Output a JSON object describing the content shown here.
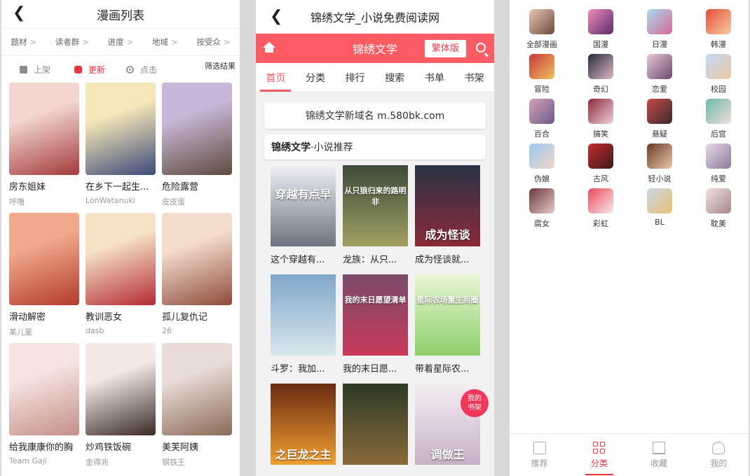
{
  "panel1": {
    "title": "漫画列表",
    "filters": [
      "题材",
      "读者群",
      "进度",
      "地域",
      "按受众"
    ],
    "sort": {
      "shelf": "上架",
      "update": "更新",
      "click": "点击"
    },
    "filter_result": "筛选结果",
    "comics": [
      {
        "title": "房东姐妹",
        "author": "呼噜",
        "c1": "#f3d6d0",
        "c2": "#a33a3a"
      },
      {
        "title": "在乡下一起生...",
        "author": "LonWatanuki",
        "c1": "#f6e7b8",
        "c2": "#3b4a78"
      },
      {
        "title": "危险露营",
        "author": "皮皮蛋",
        "c1": "#c9b6d8",
        "c2": "#5d4b3c"
      },
      {
        "title": "滑动解密",
        "author": "某儿童",
        "c1": "#f0a98c",
        "c2": "#b43a2c"
      },
      {
        "title": "教训恶女",
        "author": "dasb",
        "c1": "#f6e2c5",
        "c2": "#b32a34"
      },
      {
        "title": "孤儿复仇记",
        "author": "26",
        "c1": "#f4dccd",
        "c2": "#8e4b3a"
      },
      {
        "title": "给我康康你的胸",
        "author": "Team Gaji",
        "c1": "#f6e4df",
        "c2": "#c48f8a"
      },
      {
        "title": "炒鸡铁饭碗",
        "author": "金得兆",
        "c1": "#f2e9e4",
        "c2": "#3a2a26"
      },
      {
        "title": "美芙阿姨",
        "author": "钢铁王",
        "c1": "#e9dcd6",
        "c2": "#8a6a58"
      }
    ]
  },
  "panel2": {
    "title": "锦绣文学_小说免费阅读网",
    "brand": "锦绣文学",
    "traditional_btn": "繁体版",
    "nav": [
      "首页",
      "分类",
      "排行",
      "搜索",
      "书单",
      "书架"
    ],
    "notice": "锦绣文学新域名 m.580bk.com",
    "section_brand": "锦绣文学",
    "section_rest": "·小说推荐",
    "fab_line1": "我的",
    "fab_line2": "书架",
    "books": [
      {
        "title": "这个穿越有...",
        "cover_text": "穿越有点早",
        "c1": "#eef1f6",
        "c2": "#6d7581"
      },
      {
        "title": "龙族：从只...",
        "cover_text": "从只狼归来的路明非",
        "c1": "#3c4a3a",
        "c2": "#a0a060"
      },
      {
        "title": "成为怪谈就...",
        "cover_text": "成为怪谈",
        "c1": "#2a3346",
        "c2": "#8a2a3a"
      },
      {
        "title": "斗罗：我加...",
        "cover_text": "",
        "c1": "#7fa6c8",
        "c2": "#d9e8ee"
      },
      {
        "title": "我的末日愿...",
        "cover_text": "我的末日愿望清单",
        "c1": "#7a4a6a",
        "c2": "#c93a5a"
      },
      {
        "title": "带着星际农...",
        "cover_text": "星际农场重生到圈",
        "c1": "#e6f6d4",
        "c2": "#8ecf6a"
      },
      {
        "title": "",
        "cover_text": "之巨龙之主",
        "c1": "#6a2a10",
        "c2": "#f0a030"
      },
      {
        "title": "",
        "cover_text": "",
        "c1": "#2c3a26",
        "c2": "#8a6a3a"
      },
      {
        "title": "",
        "cover_text": "调做王",
        "c1": "#f3eef2",
        "c2": "#c7b0c8"
      }
    ]
  },
  "panel3": {
    "categories": [
      {
        "label": "全部漫画",
        "c1": "#e8c7b8",
        "c2": "#6b4a3a"
      },
      {
        "label": "国漫",
        "c1": "#f08cbc",
        "c2": "#5a2a6a"
      },
      {
        "label": "日漫",
        "c1": "#a9d8ec",
        "c2": "#d76a9a"
      },
      {
        "label": "韩漫",
        "c1": "#e84a3a",
        "c2": "#f3d0a0"
      },
      {
        "label": "冒险",
        "c1": "#c83a3a",
        "c2": "#f0c060"
      },
      {
        "label": "奇幻",
        "c1": "#2a2a3a",
        "c2": "#d8b8c8"
      },
      {
        "label": "恋爱",
        "c1": "#e8c8d8",
        "c2": "#6a4a6a"
      },
      {
        "label": "校园",
        "c1": "#c0d8f0",
        "c2": "#f0c8a8"
      },
      {
        "label": "百合",
        "c1": "#d8a0b8",
        "c2": "#6a5a8a"
      },
      {
        "label": "搞笑",
        "c1": "#8a2a3a",
        "c2": "#f0d0d8"
      },
      {
        "label": "悬疑",
        "c1": "#c84a4a",
        "c2": "#3a2a2a"
      },
      {
        "label": "后宫",
        "c1": "#6ab8a8",
        "c2": "#f0e0d8"
      },
      {
        "label": "伪娘",
        "c1": "#9ac8f0",
        "c2": "#f0d8c8"
      },
      {
        "label": "古风",
        "c1": "#c82a2a",
        "c2": "#3a1a1a"
      },
      {
        "label": "轻小说",
        "c1": "#6a3a2a",
        "c2": "#e8c8a8"
      },
      {
        "label": "纯爱",
        "c1": "#e8d8e8",
        "c2": "#8a7a9a"
      },
      {
        "label": "腐女",
        "c1": "#6a3a3a",
        "c2": "#e8c8c8"
      },
      {
        "label": "彩虹",
        "c1": "#e84a5a",
        "c2": "#f8e8e8"
      },
      {
        "label": "BL",
        "c1": "#c8d8e8",
        "c2": "#e8c070"
      },
      {
        "label": "耽美",
        "c1": "#f0e0e0",
        "c2": "#a88888"
      }
    ],
    "tabs": [
      "推荐",
      "分类",
      "收藏",
      "我的"
    ]
  }
}
